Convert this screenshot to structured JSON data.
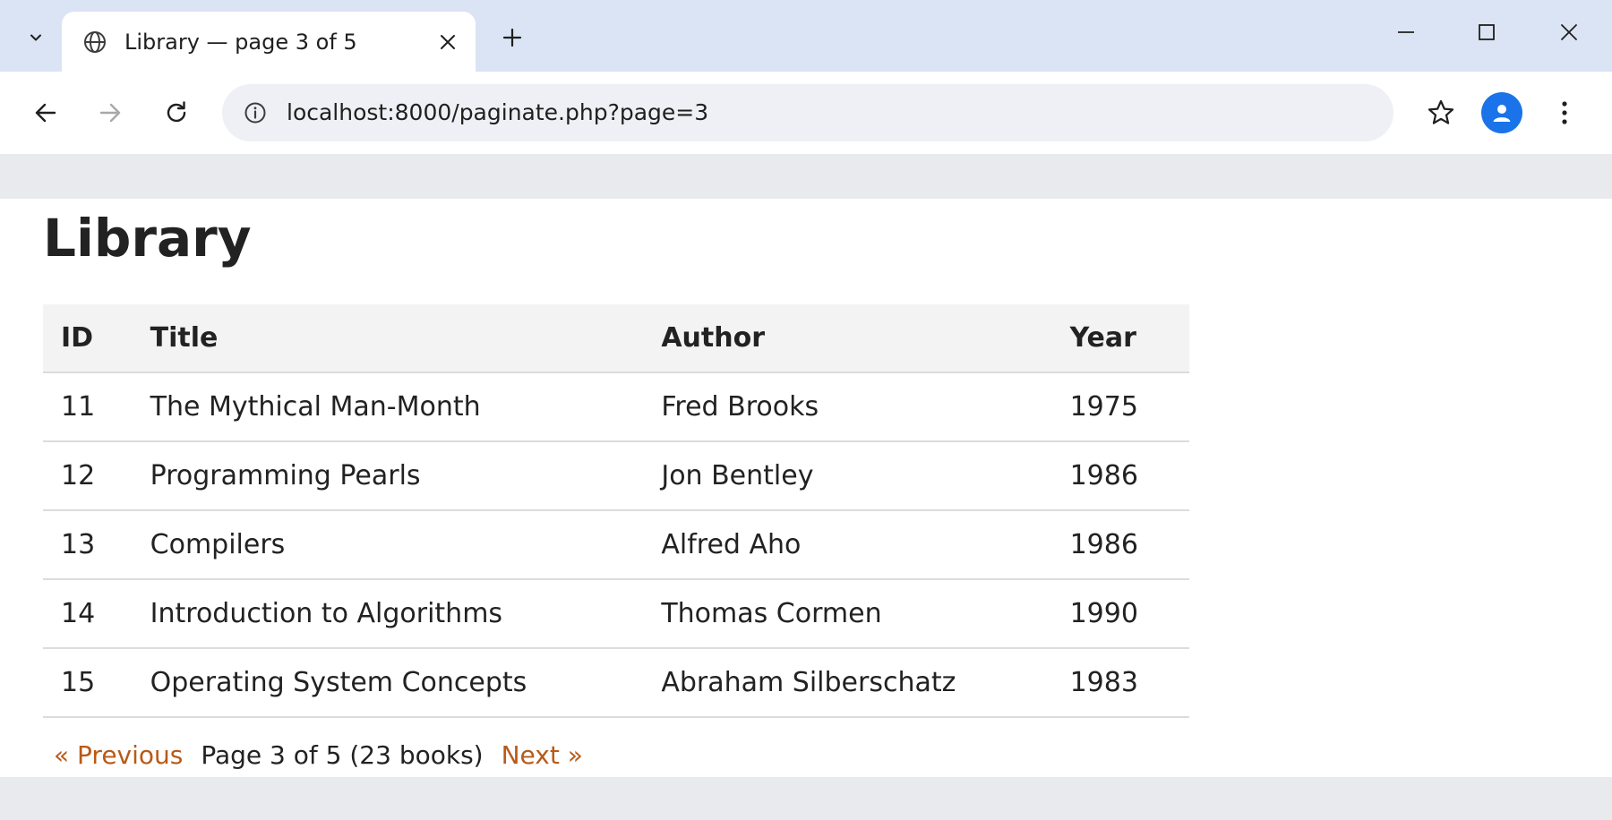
{
  "browser": {
    "tab": {
      "title": "Library — page 3 of 5"
    },
    "address_bar": {
      "url": "localhost:8000/paginate.php?page=3"
    },
    "icons": [
      "tab-search-icon",
      "globe-icon",
      "close-icon",
      "plus-icon",
      "minimize-icon",
      "maximize-icon",
      "close-window-icon",
      "back-arrow-icon",
      "forward-arrow-icon",
      "reload-icon",
      "info-icon",
      "star-icon",
      "person-icon",
      "more-vert-icon"
    ]
  },
  "page": {
    "heading": "Library",
    "table": {
      "headers": {
        "id": "ID",
        "title": "Title",
        "author": "Author",
        "year": "Year"
      },
      "rows": [
        {
          "id": "11",
          "title": "The Mythical Man-Month",
          "author": "Fred Brooks",
          "year": "1975"
        },
        {
          "id": "12",
          "title": "Programming Pearls",
          "author": "Jon Bentley",
          "year": "1986"
        },
        {
          "id": "13",
          "title": "Compilers",
          "author": "Alfred Aho",
          "year": "1986"
        },
        {
          "id": "14",
          "title": "Introduction to Algorithms",
          "author": "Thomas Cormen",
          "year": "1990"
        },
        {
          "id": "15",
          "title": "Operating System Concepts",
          "author": "Abraham Silberschatz",
          "year": "1983"
        }
      ]
    },
    "pagination": {
      "previous_label": "« Previous",
      "status": "Page 3 of 5 (23 books)",
      "next_label": "Next »"
    }
  },
  "colors": {
    "link": "#b85a17",
    "accent": "#1a73e8",
    "tabstrip": "#dbe4f4"
  }
}
